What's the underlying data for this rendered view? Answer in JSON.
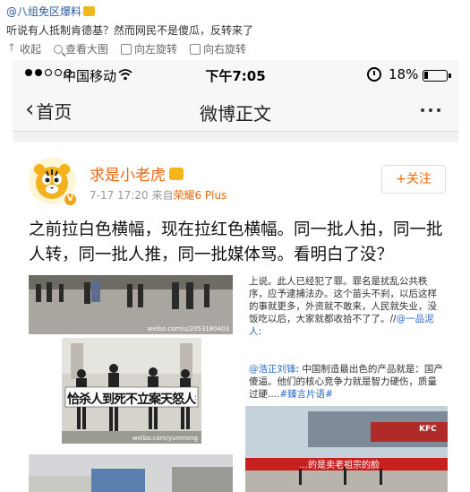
{
  "outer_post": {
    "author": "@八组免区爆料",
    "text": "听说有人抵制肯德基？然而网民不是傻瓜，反转来了",
    "toolbar": [
      "收起",
      "查看大图",
      "向左旋转",
      "向右旋转"
    ]
  },
  "status_bar": {
    "carrier": "中国移动",
    "time": "下午7:05",
    "battery": "18%"
  },
  "nav": {
    "back": "首页",
    "title": "微博正文"
  },
  "post": {
    "user_name": "求是小老虎",
    "date": "7-17 17:20",
    "source_prefix": "来自",
    "source": "荣耀6 Plus",
    "follow": "+关注",
    "text": "之前拉白色横幅，现在拉红色横幅。同一批人拍，同一批人转，同一批人推，同一批媒体骂。看明白了没？"
  },
  "images": {
    "pic1_watermark": "weibo.com/u/2053180403",
    "pic2_banner": "恰杀人到死不立案天怒人怨",
    "pic2_watermark": "weibo.com/yunmeng",
    "pic4_text_a": "上说。此人已经犯了罪。罪名是扰乱公共秩序，应予逮捕法办。这个苗头不刹，以后这样的事就更多，外资就不敢来，人民就失业，没饭吃以后，大家就都收拾不了了。//",
    "pic4_mention": "@一品泥人",
    "pic4_text_b": ":",
    "pic5_mention_a": "@浩正刘锋",
    "pic5_text": ": 中国制造最出色的产品就是：国产傻逼。他们的核心竞争力就是智力硬伤，质量过硬....",
    "pic5_mention_b": "#臻言片语#",
    "pic5_banner": "…的是卖老祖宗的脸",
    "pic5_sign": "KFC"
  }
}
